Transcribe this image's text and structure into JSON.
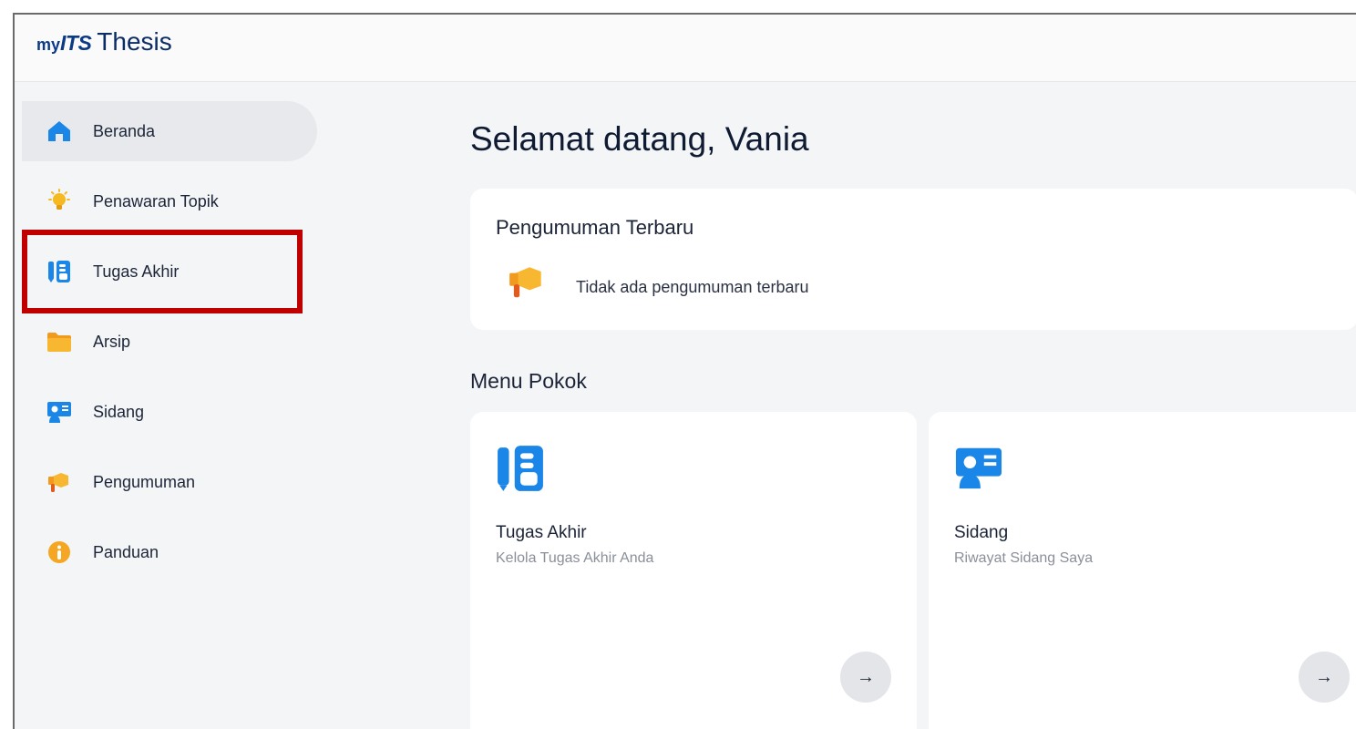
{
  "brand": {
    "my": "my",
    "its": "ITS",
    "product": "Thesis"
  },
  "sidebar": {
    "items": [
      {
        "label": "Beranda",
        "icon": "home-icon",
        "active": true
      },
      {
        "label": "Penawaran Topik",
        "icon": "lightbulb-icon",
        "active": false
      },
      {
        "label": "Tugas Akhir",
        "icon": "thesis-book-icon",
        "active": false
      },
      {
        "label": "Arsip",
        "icon": "folder-icon",
        "active": false
      },
      {
        "label": "Sidang",
        "icon": "presentation-icon",
        "active": false
      },
      {
        "label": "Pengumuman",
        "icon": "megaphone-icon",
        "active": false
      },
      {
        "label": "Panduan",
        "icon": "info-icon",
        "active": false
      }
    ]
  },
  "main": {
    "welcome": "Selamat datang, Vania",
    "announcements": {
      "title": "Pengumuman Terbaru",
      "empty_text": "Tidak ada pengumuman terbaru"
    },
    "menu": {
      "title": "Menu Pokok",
      "cards": [
        {
          "title": "Tugas Akhir",
          "subtitle": "Kelola Tugas Akhir Anda",
          "icon": "thesis-book-icon",
          "arrow": "→"
        },
        {
          "title": "Sidang",
          "subtitle": "Riwayat Sidang Saya",
          "icon": "presentation-icon",
          "arrow": "→"
        }
      ]
    }
  },
  "colors": {
    "brand": "#0b3a86",
    "highlight": "#c00000",
    "active_nav": "#e7e9ec",
    "background": "#f4f5f7",
    "icon_blue": "#1a86e8",
    "icon_orange": "#f5a623"
  }
}
